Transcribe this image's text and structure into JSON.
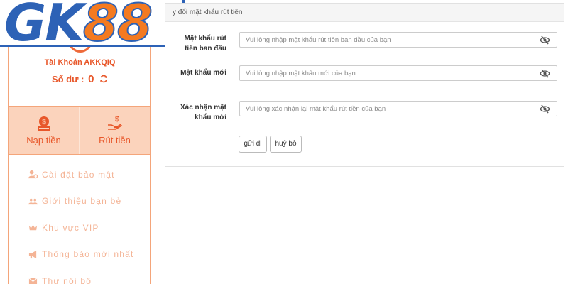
{
  "brand": {
    "logo_gk": "GK",
    "logo_88": "88"
  },
  "account": {
    "name": "Tài Khoản AKKQIQ",
    "balance_label": "Số dư :",
    "balance_value": "0"
  },
  "actions": {
    "deposit_label": "Nạp tiền",
    "withdraw_label": "Rút tiền"
  },
  "menu": {
    "items": [
      {
        "label": "Cài đặt bảo mật",
        "icon": "user-gear-icon"
      },
      {
        "label": "Giới thiệu bạn bè",
        "icon": "users-icon"
      },
      {
        "label": "Khu vực VIP",
        "icon": "crown-icon"
      },
      {
        "label": "Thông báo mới nhất",
        "icon": "megaphone-icon"
      },
      {
        "label": "Thư nội bộ",
        "icon": "envelope-icon"
      }
    ]
  },
  "form": {
    "title": "y đổi mật khẩu rút tiền",
    "fields": [
      {
        "label_line1": "Mật khẩu rút",
        "label_line2": "tiền ban đầu",
        "placeholder": "Vui lòng nhập mật khẩu rút tiền ban đầu của bạn",
        "value": ""
      },
      {
        "label_line1": "Mật khẩu mới",
        "label_line2": "",
        "placeholder": "Vui lòng nhập mật khẩu mới của bạn",
        "value": ""
      },
      {
        "label_line1": "Xác nhận mật",
        "label_line2": "khẩu mới",
        "placeholder": "Vui lòng xác nhận lại mật khẩu rút tiền của bạn",
        "value": ""
      }
    ],
    "submit_label": "gửi đi",
    "cancel_label": "huỷ bỏ"
  },
  "colors": {
    "accent": "#e8572a",
    "accent_light": "#fbd3bc",
    "menu_text": "#f4b496",
    "logo_blue": "#2d62b6",
    "logo_orange": "#f47a20"
  }
}
